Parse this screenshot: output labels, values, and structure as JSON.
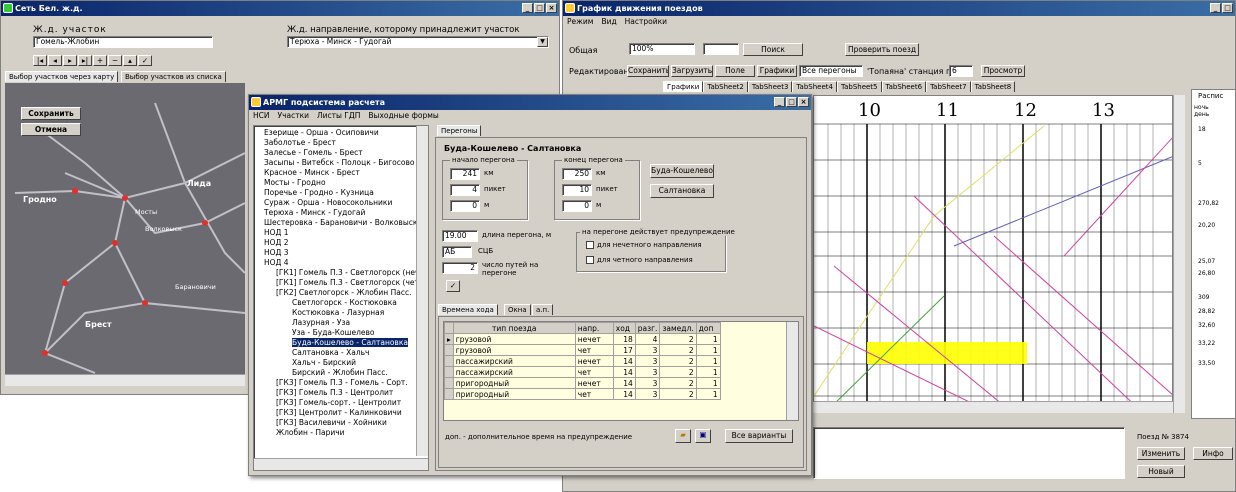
{
  "win1": {
    "title": "Сеть Бел. ж.д.",
    "section_label": "Ж.д. участок",
    "section_value": "Гомель-Жлобин",
    "direction_label": "Ж.д. направление, которому принадлежит участок",
    "direction_value": "Терюха - Минск - Гудогай",
    "tabs": [
      "Выбор участков через карту",
      "Выбор участков из списка"
    ],
    "save": "Сохранить",
    "cancel": "Отмена",
    "map_labels": [
      "Гродно",
      "Лида",
      "Мосты",
      "Волковыск",
      "Барановичи",
      "Брест"
    ]
  },
  "win2": {
    "title": "График движения поездов",
    "menu": [
      "Режим",
      "Вид",
      "Настройки"
    ],
    "common_label": "Общая",
    "zoom": "100%",
    "search_btn": "Поиск",
    "check_btn": "Проверить поезд",
    "edit_label": "Редактирование",
    "edit_buttons": [
      "Сохранить",
      "Загрузить",
      "Поле",
      "Графики"
    ],
    "filter": "Все перегоны",
    "station_label": "'Топаяна' станция по",
    "station_value": "6",
    "view_btn": "Просмотр",
    "sheets": [
      "Графики",
      "TabSheet2",
      "TabSheet3",
      "TabSheet4",
      "TabSheet5",
      "TabSheet6",
      "TabSheet7",
      "TabSheet8"
    ],
    "hours": [
      "10",
      "11",
      "12",
      "13"
    ],
    "side_header": "Распис",
    "side_cols": [
      "ночь",
      "день"
    ],
    "side_values": [
      "18",
      "5",
      "270,82",
      "20,20",
      "25,07",
      "26,80",
      "309",
      "28,82",
      "32,60",
      "33,22",
      "33,50"
    ],
    "train_label": "Поезд № 3874",
    "change_btn": "Изменить",
    "info_btn": "Инфо",
    "new_btn": "Новый"
  },
  "win3": {
    "title": "АРМГ подсистема расчета",
    "menu": [
      "НСИ",
      "Участки",
      "Листы ГДП",
      "Выходные формы"
    ],
    "tree": [
      "Езерище - Орша - Осиповичи",
      "Заболотье - Брест",
      "Залесье - Гомель - Брест",
      "Засыпы - Витебск - Полоцк - Бигосово",
      "Красное - Минск - Брест",
      "Мосты - Гродно",
      "Поречье - Гродно - Кузница",
      "Сураж - Орша - Новосокольники",
      "Терюха - Минск - Гудогай",
      "Шестеровка - Барановичи - Волковыск",
      "НОД 1",
      "НОД 2",
      "НОД 3",
      "НОД 4",
      "[ГК1] Гомель П.3 - Светлогорск (нечет)",
      "[ГК1] Гомель П.3 - Светлогорск (чет)",
      "[ГК2] Светлогорск - Жлобин Пасс.",
      "Светлогорск - Костюковка",
      "Костюковка - Лазурная",
      "Лазурная - Уза",
      "Уза - Буда-Кошелево",
      "Буда-Кошелево - Салтановка",
      "Салтановка - Хальч",
      "Хальч - Бирский",
      "Бирский - Жлобин Пасс.",
      "[ГК3] Гомель П.3 - Гомель - Сорт.",
      "[ГК3] Гомель П.3 - Центролит",
      "[ГК3] Гомель-сорт. - Центролит",
      "[ГК3] Центролит - Калинковичи",
      "[ГК3] Василевичи - Хойники",
      "Жлобин - Паричи"
    ],
    "tree_selected": 21,
    "tab": "Перегоны",
    "stretch_title": "Буда-Кошелево - Салтановка",
    "start_label": "начало перегона",
    "end_label": "конец перегона",
    "start": [
      "241",
      "4",
      "0"
    ],
    "end": [
      "250",
      "10",
      "0"
    ],
    "units": [
      "км",
      "пикет",
      "м"
    ],
    "btn_start": "Буда-Кошелево",
    "btn_end": "Салтановка",
    "length": "19.00",
    "length_label": "длина перегона, м",
    "ab": "АБ",
    "ssb": "СЦБ",
    "ways": "2",
    "ways_label": "число путей на перегоне",
    "warn_label": "на перегоне действует предупреждение",
    "odd_dir": "для нечетного направления",
    "even_dir": "для четного направления",
    "lower_tabs": [
      "Времена хода",
      "Окна",
      "а.п."
    ],
    "cols": [
      "тип поезда",
      "напр.",
      "ход",
      "разг.",
      "замедл.",
      "доп"
    ],
    "rows": [
      [
        "грузовой",
        "нечет",
        "18",
        "4",
        "2",
        "1"
      ],
      [
        "грузовой",
        "чет",
        "17",
        "3",
        "2",
        "1"
      ],
      [
        "пассажирский",
        "нечет",
        "14",
        "3",
        "2",
        "1"
      ],
      [
        "пассажирский",
        "чет",
        "14",
        "3",
        "2",
        "1"
      ],
      [
        "пригородный",
        "нечет",
        "14",
        "3",
        "2",
        "1"
      ],
      [
        "пригородный",
        "чет",
        "14",
        "3",
        "2",
        "1"
      ]
    ],
    "note": "доп. - дополнительное время на предупреждение",
    "all_btn": "Все варианты"
  }
}
